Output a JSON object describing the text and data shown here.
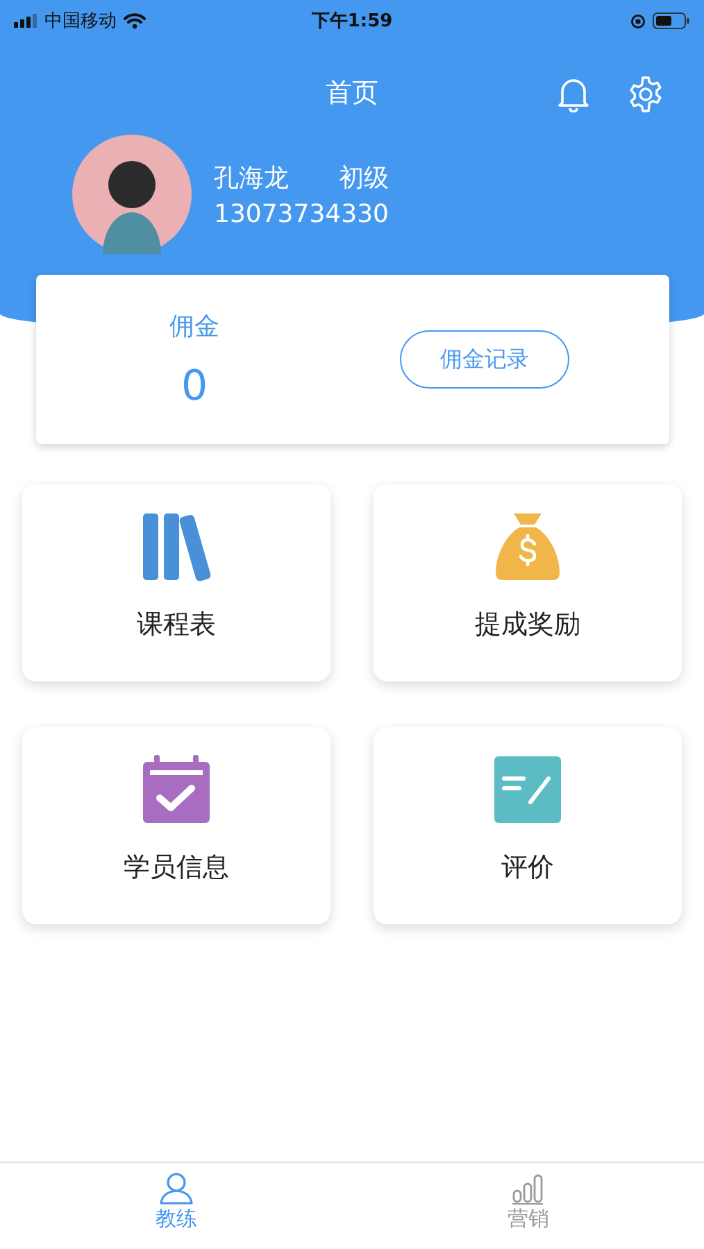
{
  "status_bar": {
    "carrier": "中国移动",
    "time": "下午1:59"
  },
  "header": {
    "title": "首页"
  },
  "profile": {
    "name": "孔海龙",
    "level": "初级",
    "phone": "13073734330"
  },
  "commission": {
    "label": "佣金",
    "amount": "0",
    "button": "佣金记录"
  },
  "tiles": [
    {
      "label": "课程表",
      "kind": "books"
    },
    {
      "label": "提成奖励",
      "kind": "money-bag"
    },
    {
      "label": "学员信息",
      "kind": "calendar"
    },
    {
      "label": "评价",
      "kind": "note"
    }
  ],
  "tabs": [
    {
      "label": "教练",
      "kind": "person",
      "selected": true
    },
    {
      "label": "营销",
      "kind": "chart",
      "selected": false
    }
  ]
}
